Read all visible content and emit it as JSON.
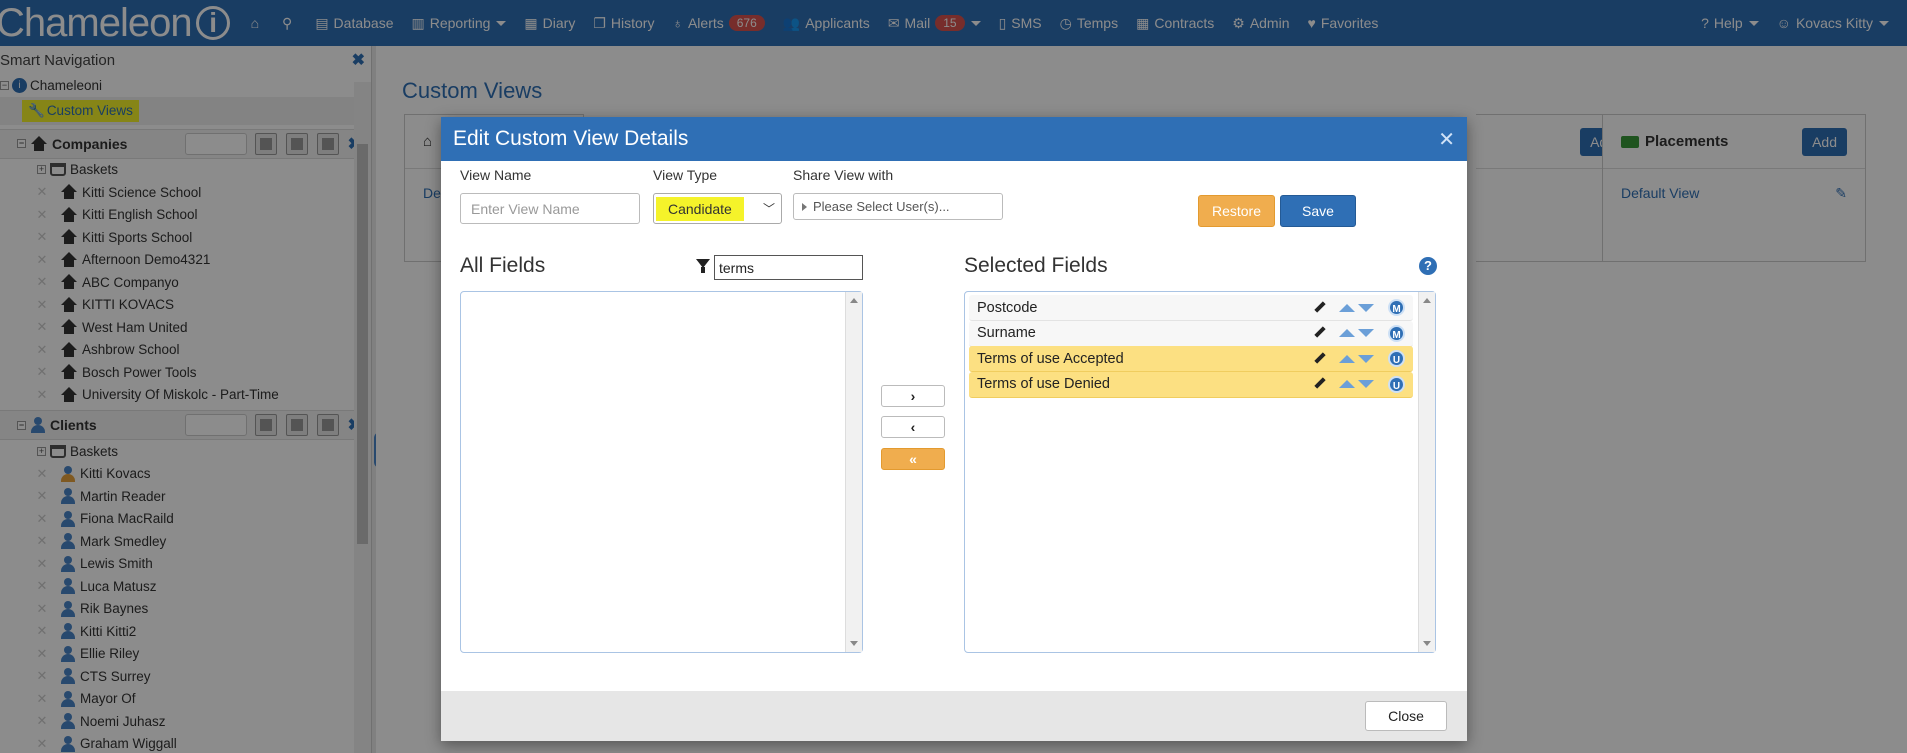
{
  "app": {
    "logo_text": "Chameleon",
    "logo_mark": "i"
  },
  "nav": {
    "items": [
      {
        "label": "",
        "icon": "home-icon"
      },
      {
        "label": "",
        "icon": "search-icon"
      },
      {
        "label": "Database",
        "icon": "database-icon"
      },
      {
        "label": "Reporting",
        "icon": "chart-icon",
        "dropdown": true
      },
      {
        "label": "Diary",
        "icon": "calendar-icon"
      },
      {
        "label": "History",
        "icon": "book-icon"
      },
      {
        "label": "Alerts",
        "icon": "lightbulb-icon",
        "badge": "676"
      },
      {
        "label": "Applicants",
        "icon": "users-icon"
      },
      {
        "label": "Mail",
        "icon": "envelope-icon",
        "badge": "15",
        "dropdown": true
      },
      {
        "label": "SMS",
        "icon": "mobile-icon"
      },
      {
        "label": "Temps",
        "icon": "clock-icon"
      },
      {
        "label": "Contracts",
        "icon": "table-icon"
      },
      {
        "label": "Admin",
        "icon": "gears-icon"
      },
      {
        "label": "Favorites",
        "icon": "heart-icon"
      }
    ],
    "right": [
      {
        "label": "Help",
        "icon": "question-icon"
      },
      {
        "label": "Kovacs Kitty",
        "icon": "user-icon"
      }
    ]
  },
  "sidebar": {
    "title": "Smart Navigation",
    "root": "Chameleoni",
    "custom_views": "Custom Views",
    "companies": {
      "title": "Companies",
      "baskets": "Baskets",
      "items": [
        "Kitti Science School",
        "Kitti English School",
        "Kitti Sports School",
        "Afternoon Demo4321",
        "ABC Companyo",
        "KITTI KOVACS",
        "West Ham United",
        "Ashbrow School",
        "Bosch Power Tools",
        "University Of Miskolc - Part-Time"
      ]
    },
    "clients": {
      "title": "Clients",
      "baskets": "Baskets",
      "items": [
        "Kitti Kovacs",
        "Martin Reader",
        "Fiona MacRaild",
        "Mark Smedley",
        "Lewis Smith",
        "Luca Matusz",
        "Rik Baynes",
        "Kitti Kitti2",
        "Ellie Riley",
        "CTS Surrey",
        "Mayor Of",
        "Noemi Juhasz",
        "Graham Wiggall"
      ]
    }
  },
  "main": {
    "title": "Custom Views",
    "panels": [
      {
        "title": "Placements",
        "add_label": "Add",
        "link": "Default View"
      }
    ],
    "partial_add_label": "Add",
    "partial_link": "De"
  },
  "modal": {
    "title": "Edit Custom View Details",
    "view_name_label": "View Name",
    "view_name_placeholder": "Enter View Name",
    "view_type_label": "View Type",
    "view_type_value": "Candidate",
    "share_label": "Share View with",
    "share_placeholder": "Please Select User(s)...",
    "restore_label": "Restore",
    "save_label": "Save",
    "all_fields_title": "All Fields",
    "filter_value": "terms",
    "selected_fields_title": "Selected Fields",
    "help_glyph": "?",
    "selected_fields": [
      {
        "label": "Postcode",
        "badge": "M",
        "highlight": false
      },
      {
        "label": "Surname",
        "badge": "M",
        "highlight": false
      },
      {
        "label": "Terms of use Accepted",
        "badge": "U",
        "highlight": true
      },
      {
        "label": "Terms of use Denied",
        "badge": "U",
        "highlight": true
      }
    ],
    "move_right_glyph": "›",
    "move_left_glyph": "‹",
    "move_all_left_glyph": "«",
    "close_label": "Close"
  },
  "colors": {
    "primary": "#2f6fb5",
    "accent": "#f0ad4e",
    "highlight": "#f5f32a",
    "selected_yellow": "#fce082",
    "badge_red": "#d9534f"
  }
}
